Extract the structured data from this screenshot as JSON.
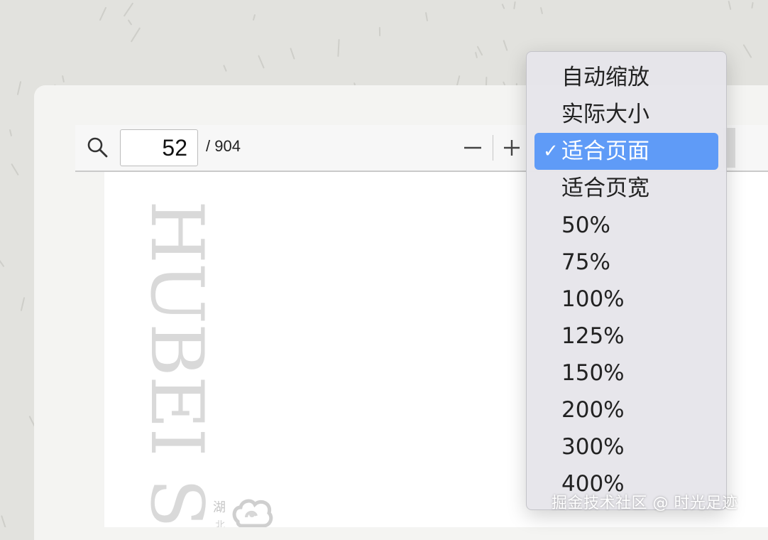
{
  "toolbar": {
    "current_page": "52",
    "page_total": "/ 904",
    "search_icon": "search-icon",
    "zoom_out_icon": "minus-icon",
    "zoom_in_icon": "plus-icon"
  },
  "document": {
    "title": "HUBEI S",
    "seal_text": "湖",
    "seal_text_2": "北",
    "logo": "cloud-emblem-logo"
  },
  "zoom_menu": {
    "selected": "适合页面",
    "check_glyph": "✓",
    "items": [
      "自动缩放",
      "实际大小",
      "适合页面",
      "适合页宽",
      "50%",
      "75%",
      "100%",
      "125%",
      "150%",
      "200%",
      "300%",
      "400%"
    ]
  },
  "watermark": "掘金技术社区 @ 时光足迹",
  "colors": {
    "selection": "#5f9bf7",
    "menu_background": "#e6e5ea",
    "toolbar_background": "#f7f7f7",
    "backdrop": "#e2e2de"
  }
}
